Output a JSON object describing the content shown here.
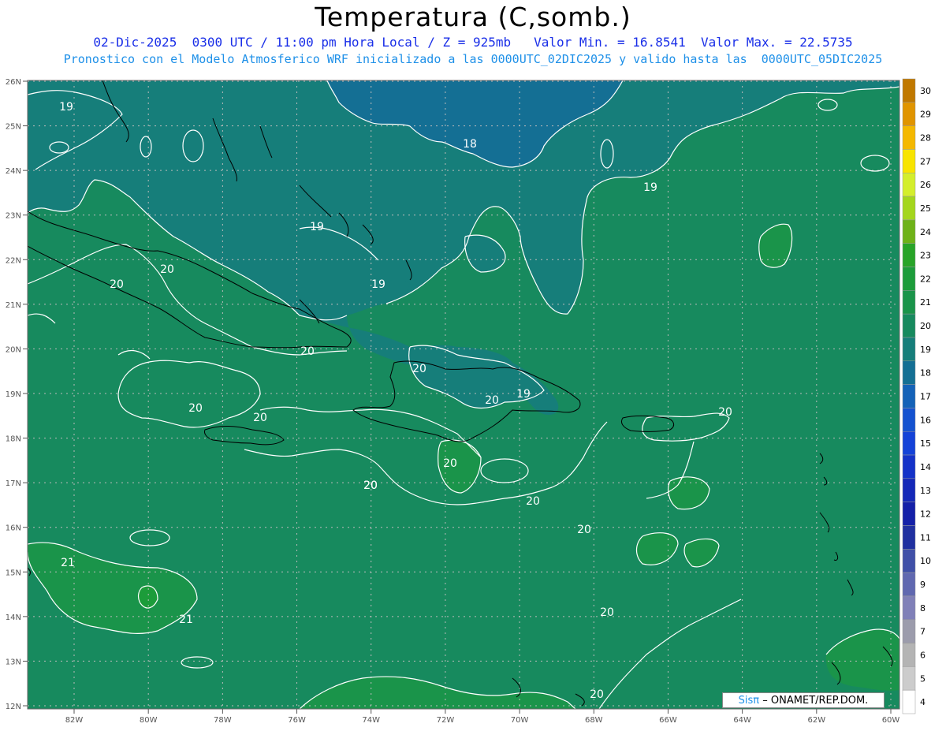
{
  "header": {
    "title": "Temperatura (C,somb.)",
    "line1": "02-Dic-2025  0300 UTC / 11:00 pm Hora Local / Z = 925mb   Valor Min. = 16.8541  Valor Max. = 22.5735",
    "line2": "Pronostico con el Modelo Atmosferico WRF inicializado a las 0000UTC_02DIC2025 y valido hasta las  0000UTC_05DIC2025"
  },
  "map": {
    "lat_labels": [
      "26N",
      "25N",
      "24N",
      "23N",
      "22N",
      "21N",
      "20N",
      "19N",
      "18N",
      "17N",
      "16N",
      "15N",
      "14N",
      "13N",
      "12N"
    ],
    "lon_labels": [
      "82W",
      "80W",
      "78W",
      "76W",
      "74W",
      "72W",
      "70W",
      "68W",
      "66W",
      "64W",
      "62W",
      "60W"
    ],
    "contour_labels": [
      {
        "text": "19"
      },
      {
        "text": "18"
      },
      {
        "text": "19"
      },
      {
        "text": "19"
      },
      {
        "text": "20"
      },
      {
        "text": "20"
      },
      {
        "text": "19"
      },
      {
        "text": "20"
      },
      {
        "text": "20"
      },
      {
        "text": "20"
      },
      {
        "text": "19"
      },
      {
        "text": "20"
      },
      {
        "text": "20"
      },
      {
        "text": "20"
      },
      {
        "text": "20"
      },
      {
        "text": "20"
      },
      {
        "text": "20"
      },
      {
        "text": "21"
      },
      {
        "text": "21"
      },
      {
        "text": "20"
      },
      {
        "text": "20"
      },
      {
        "text": "20"
      },
      {
        "text": "20"
      }
    ],
    "palette": {
      "c18": "#146f94",
      "c19": "#167e7a",
      "c20": "#178a5e",
      "c21": "#1a944a",
      "c22": "#1c9c3a",
      "contour": "#ffffff",
      "coast": "#000000",
      "grid": "#bbbbbb"
    }
  },
  "colorbar": {
    "labels": [
      "30",
      "29",
      "28",
      "27",
      "26",
      "25",
      "24",
      "23",
      "22",
      "21",
      "20",
      "19",
      "18",
      "17",
      "16",
      "15",
      "14",
      "13",
      "12",
      "11",
      "10",
      "9",
      "8",
      "7",
      "6",
      "5",
      "4"
    ],
    "colors": [
      "#c07800",
      "#e09400",
      "#f4b800",
      "#f8e400",
      "#d4ee2c",
      "#a4d61c",
      "#6eb218",
      "#28a428",
      "#1c9c3a",
      "#1a944a",
      "#178a5e",
      "#167e7a",
      "#146f94",
      "#1462b8",
      "#1452d0",
      "#1442d8",
      "#1432c8",
      "#1428b8",
      "#1420a8",
      "#2030a0",
      "#4050a8",
      "#6068b0",
      "#8080b8",
      "#9c9cac",
      "#b4b4b4",
      "#cccccc",
      "#ffffff"
    ]
  },
  "credit": {
    "sis": "Sisπ",
    "rest": "– ONAMET/REP.DOM."
  }
}
